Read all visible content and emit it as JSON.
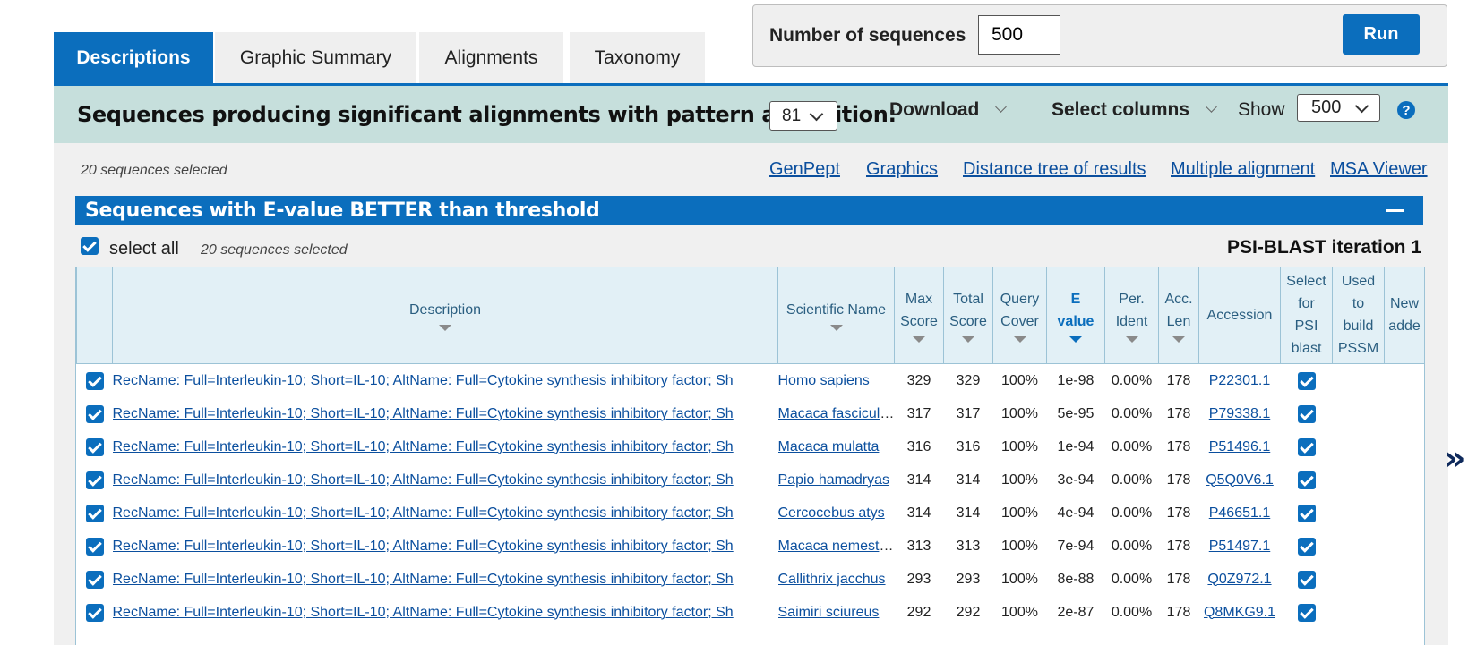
{
  "tabs": [
    {
      "label": "Descriptions",
      "active": true
    },
    {
      "label": "Graphic Summary",
      "active": false
    },
    {
      "label": "Alignments",
      "active": false
    },
    {
      "label": "Taxonomy",
      "active": false
    }
  ],
  "seq_control": {
    "label": "Number of sequences",
    "value": "500",
    "run_label": "Run"
  },
  "header": {
    "title": "Sequences producing significant alignments with pattern at position:",
    "position_value": "81",
    "download_label": "Download",
    "select_columns_label": "Select columns",
    "show_label": "Show",
    "show_value": "500",
    "help_label": "?"
  },
  "selection_note": "20 sequences selected",
  "links": [
    "GenPept",
    "Graphics",
    "Distance tree of results",
    "Multiple alignment",
    "MSA Viewer"
  ],
  "section": {
    "title": "Sequences with E-value BETTER than threshold",
    "select_all_label": "select all",
    "selected_note": "20 sequences selected",
    "iteration_label": "PSI-BLAST iteration 1"
  },
  "table": {
    "columns": [
      {
        "label": "Description",
        "lines": [
          "Description"
        ],
        "sortable": true
      },
      {
        "label": "Scientific Name",
        "lines": [
          "Scientific Name"
        ],
        "sortable": true
      },
      {
        "label": "Max Score",
        "lines": [
          "Max",
          "Score"
        ],
        "sortable": true
      },
      {
        "label": "Total Score",
        "lines": [
          "Total",
          "Score"
        ],
        "sortable": true
      },
      {
        "label": "Query Cover",
        "lines": [
          "Query",
          "Cover"
        ],
        "sortable": true
      },
      {
        "label": "E value",
        "lines": [
          "E",
          "value"
        ],
        "sortable": true,
        "sorted": true
      },
      {
        "label": "Per. Ident",
        "lines": [
          "Per.",
          "Ident"
        ],
        "sortable": true
      },
      {
        "label": "Acc. Len",
        "lines": [
          "Acc.",
          "Len"
        ],
        "sortable": true
      },
      {
        "label": "Accession",
        "lines": [
          "Accession"
        ],
        "sortable": false
      },
      {
        "label": "Select for PSI blast",
        "lines": [
          "Select",
          "for",
          "PSI",
          "blast"
        ],
        "sortable": false
      },
      {
        "label": "Used to build PSSM",
        "lines": [
          "Used",
          "to",
          "build",
          "PSSM"
        ],
        "sortable": false
      },
      {
        "label": "New added",
        "lines": [
          "New",
          "adde"
        ],
        "sortable": false
      }
    ],
    "rows": [
      {
        "description": "RecName: Full=Interleukin-10; Short=IL-10; AltName: Full=Cytokine synthesis inhibitory factor; Sh",
        "scientific_name": "Homo sapiens",
        "max_score": "329",
        "total_score": "329",
        "query_cover": "100%",
        "e_value": "1e-98",
        "per_ident": "0.00%",
        "acc_len": "178",
        "accession": "P22301.1"
      },
      {
        "description": "RecName: Full=Interleukin-10; Short=IL-10; AltName: Full=Cytokine synthesis inhibitory factor; Sh",
        "scientific_name": "Macaca fascicularis",
        "max_score": "317",
        "total_score": "317",
        "query_cover": "100%",
        "e_value": "5e-95",
        "per_ident": "0.00%",
        "acc_len": "178",
        "accession": "P79338.1"
      },
      {
        "description": "RecName: Full=Interleukin-10; Short=IL-10; AltName: Full=Cytokine synthesis inhibitory factor; Sh",
        "scientific_name": "Macaca mulatta",
        "max_score": "316",
        "total_score": "316",
        "query_cover": "100%",
        "e_value": "1e-94",
        "per_ident": "0.00%",
        "acc_len": "178",
        "accession": "P51496.1"
      },
      {
        "description": "RecName: Full=Interleukin-10; Short=IL-10; AltName: Full=Cytokine synthesis inhibitory factor; Sh",
        "scientific_name": "Papio hamadryas",
        "max_score": "314",
        "total_score": "314",
        "query_cover": "100%",
        "e_value": "3e-94",
        "per_ident": "0.00%",
        "acc_len": "178",
        "accession": "Q5Q0V6.1"
      },
      {
        "description": "RecName: Full=Interleukin-10; Short=IL-10; AltName: Full=Cytokine synthesis inhibitory factor; Sh",
        "scientific_name": "Cercocebus atys",
        "max_score": "314",
        "total_score": "314",
        "query_cover": "100%",
        "e_value": "4e-94",
        "per_ident": "0.00%",
        "acc_len": "178",
        "accession": "P46651.1"
      },
      {
        "description": "RecName: Full=Interleukin-10; Short=IL-10; AltName: Full=Cytokine synthesis inhibitory factor; Sh",
        "scientific_name": "Macaca nemestrina",
        "max_score": "313",
        "total_score": "313",
        "query_cover": "100%",
        "e_value": "7e-94",
        "per_ident": "0.00%",
        "acc_len": "178",
        "accession": "P51497.1"
      },
      {
        "description": "RecName: Full=Interleukin-10; Short=IL-10; AltName: Full=Cytokine synthesis inhibitory factor; Sh",
        "scientific_name": "Callithrix jacchus",
        "max_score": "293",
        "total_score": "293",
        "query_cover": "100%",
        "e_value": "8e-88",
        "per_ident": "0.00%",
        "acc_len": "178",
        "accession": "Q0Z972.1"
      },
      {
        "description": "RecName: Full=Interleukin-10; Short=IL-10; AltName: Full=Cytokine synthesis inhibitory factor; Sh",
        "scientific_name": "Saimiri sciureus",
        "max_score": "292",
        "total_score": "292",
        "query_cover": "100%",
        "e_value": "2e-87",
        "per_ident": "0.00%",
        "acc_len": "178",
        "accession": "Q8MKG9.1"
      }
    ]
  },
  "colors": {
    "accent": "#0b6ebd",
    "band": "#c6dfdc",
    "link": "#0b4f9e",
    "header_cell": "#e2f0f6"
  },
  "icons": {
    "next": "double-chevron-right-icon",
    "help": "help-icon",
    "collapse": "minus-icon"
  }
}
